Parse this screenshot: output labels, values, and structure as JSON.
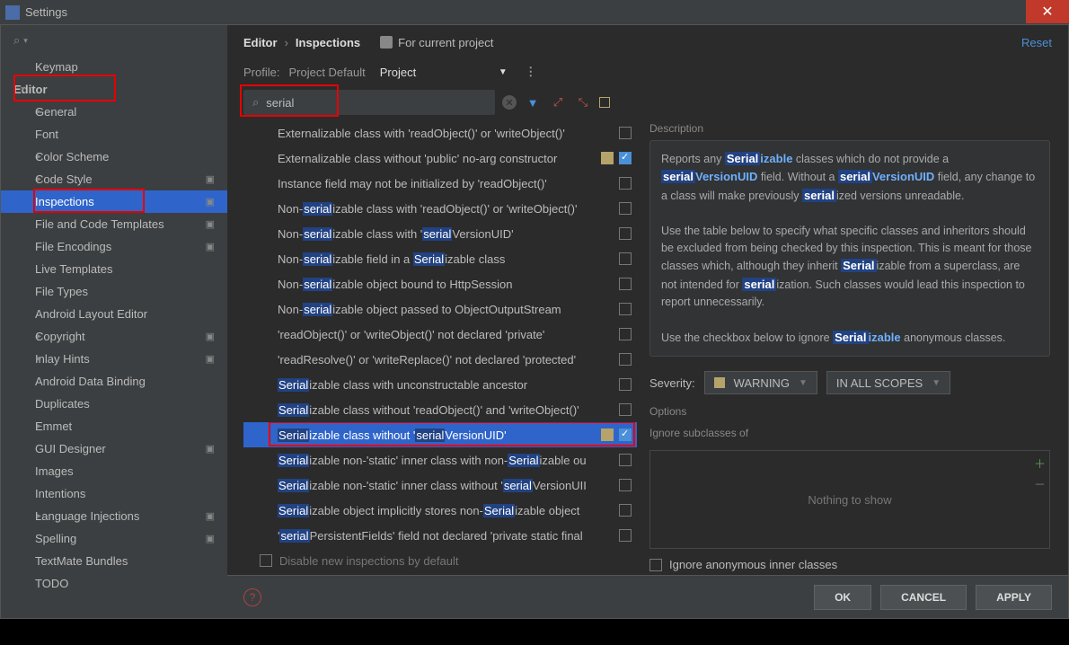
{
  "window": {
    "title": "Settings"
  },
  "breadcrumb": {
    "root": "Editor",
    "leaf": "Inspections",
    "for_current": "For current project",
    "reset": "Reset"
  },
  "profile": {
    "label": "Profile:",
    "value1": "Project Default",
    "value2": "Project"
  },
  "search": {
    "value": "serial"
  },
  "sidebar": [
    {
      "lv": 1,
      "label": "Keymap"
    },
    {
      "lv": 0,
      "label": "Editor",
      "exp": "▾",
      "hl_red": true
    },
    {
      "lv": 1,
      "label": "General",
      "exp": "▸"
    },
    {
      "lv": 1,
      "label": "Font"
    },
    {
      "lv": 1,
      "label": "Color Scheme",
      "exp": "▸"
    },
    {
      "lv": 1,
      "label": "Code Style",
      "exp": "▸",
      "prj": true
    },
    {
      "lv": 1,
      "label": "Inspections",
      "selected": true,
      "prj": true,
      "hl_red": true
    },
    {
      "lv": 1,
      "label": "File and Code Templates",
      "prj": true
    },
    {
      "lv": 1,
      "label": "File Encodings",
      "prj": true
    },
    {
      "lv": 1,
      "label": "Live Templates"
    },
    {
      "lv": 1,
      "label": "File Types"
    },
    {
      "lv": 1,
      "label": "Android Layout Editor"
    },
    {
      "lv": 1,
      "label": "Copyright",
      "exp": "▸",
      "prj": true
    },
    {
      "lv": 1,
      "label": "Inlay Hints",
      "exp": "▸",
      "prj": true
    },
    {
      "lv": 1,
      "label": "Android Data Binding"
    },
    {
      "lv": 1,
      "label": "Duplicates"
    },
    {
      "lv": 1,
      "label": "Emmet",
      "exp": "▸"
    },
    {
      "lv": 1,
      "label": "GUI Designer",
      "prj": true
    },
    {
      "lv": 1,
      "label": "Images"
    },
    {
      "lv": 1,
      "label": "Intentions"
    },
    {
      "lv": 1,
      "label": "Language Injections",
      "exp": "▸",
      "prj": true
    },
    {
      "lv": 1,
      "label": "Spelling",
      "prj": true
    },
    {
      "lv": 1,
      "label": "TextMate Bundles"
    },
    {
      "lv": 1,
      "label": "TODO"
    }
  ],
  "inspections": [
    {
      "parts": [
        "Externalizable class with 'readObject()' or 'writeObject()'"
      ],
      "hl": [],
      "checked": false
    },
    {
      "parts": [
        "Externalizable class without 'public' no-arg constructor"
      ],
      "hl": [],
      "sev": true,
      "checked": true
    },
    {
      "parts": [
        "Instance field may not be initialized by 'readObject()'"
      ],
      "hl": [],
      "checked": false
    },
    {
      "parts": [
        "Non-",
        "serial",
        "izable class with 'readObject()' or 'writeObject()'"
      ],
      "hl": [
        1
      ],
      "checked": false
    },
    {
      "parts": [
        "Non-",
        "serial",
        "izable class with '",
        "serial",
        "VersionUID'"
      ],
      "hl": [
        1,
        3
      ],
      "checked": false
    },
    {
      "parts": [
        "Non-",
        "serial",
        "izable field in a ",
        "Serial",
        "izable class"
      ],
      "hl": [
        1,
        3
      ],
      "checked": false
    },
    {
      "parts": [
        "Non-",
        "serial",
        "izable object bound to HttpSession"
      ],
      "hl": [
        1
      ],
      "checked": false
    },
    {
      "parts": [
        "Non-",
        "serial",
        "izable object passed to ObjectOutputStream"
      ],
      "hl": [
        1
      ],
      "checked": false
    },
    {
      "parts": [
        "'readObject()' or 'writeObject()' not declared 'private'"
      ],
      "hl": [],
      "checked": false
    },
    {
      "parts": [
        "'readResolve()' or 'writeReplace()' not declared 'protected'"
      ],
      "hl": [],
      "checked": false
    },
    {
      "parts": [
        "Serial",
        "izable class with unconstructable ancestor"
      ],
      "hl": [
        0
      ],
      "checked": false
    },
    {
      "parts": [
        "Serial",
        "izable class without 'readObject()' and 'writeObject()'"
      ],
      "hl": [
        0
      ],
      "checked": false
    },
    {
      "parts": [
        "Serial",
        "izable class without '",
        "serial",
        "VersionUID'"
      ],
      "hl": [
        0,
        2
      ],
      "sev": true,
      "checked": true,
      "selected": true,
      "hl_red": true
    },
    {
      "parts": [
        "Serial",
        "izable non-'static' inner class with non-",
        "Serial",
        "izable ou"
      ],
      "hl": [
        0,
        2
      ],
      "checked": false
    },
    {
      "parts": [
        "Serial",
        "izable non-'static' inner class without '",
        "serial",
        "VersionUII"
      ],
      "hl": [
        0,
        2
      ],
      "checked": false
    },
    {
      "parts": [
        "Serial",
        "izable object implicitly stores non-",
        "Serial",
        "izable object"
      ],
      "hl": [
        0,
        2
      ],
      "checked": false
    },
    {
      "parts": [
        "'",
        "serial",
        "PersistentFields' field not declared 'private static final"
      ],
      "hl": [
        1
      ],
      "checked": false
    }
  ],
  "bottom": {
    "disable_new": "Disable new inspections by default"
  },
  "detail": {
    "desc_h": "Description",
    "sev_label": "Severity:",
    "sev_value": "WARNING",
    "scope_value": "IN ALL SCOPES",
    "opt_h": "Options",
    "sub_h": "Ignore subclasses of",
    "nothing": "Nothing to show",
    "ignore_anon": "Ignore anonymous inner classes"
  },
  "footer": {
    "ok": "OK",
    "cancel": "CANCEL",
    "apply": "APPLY"
  }
}
